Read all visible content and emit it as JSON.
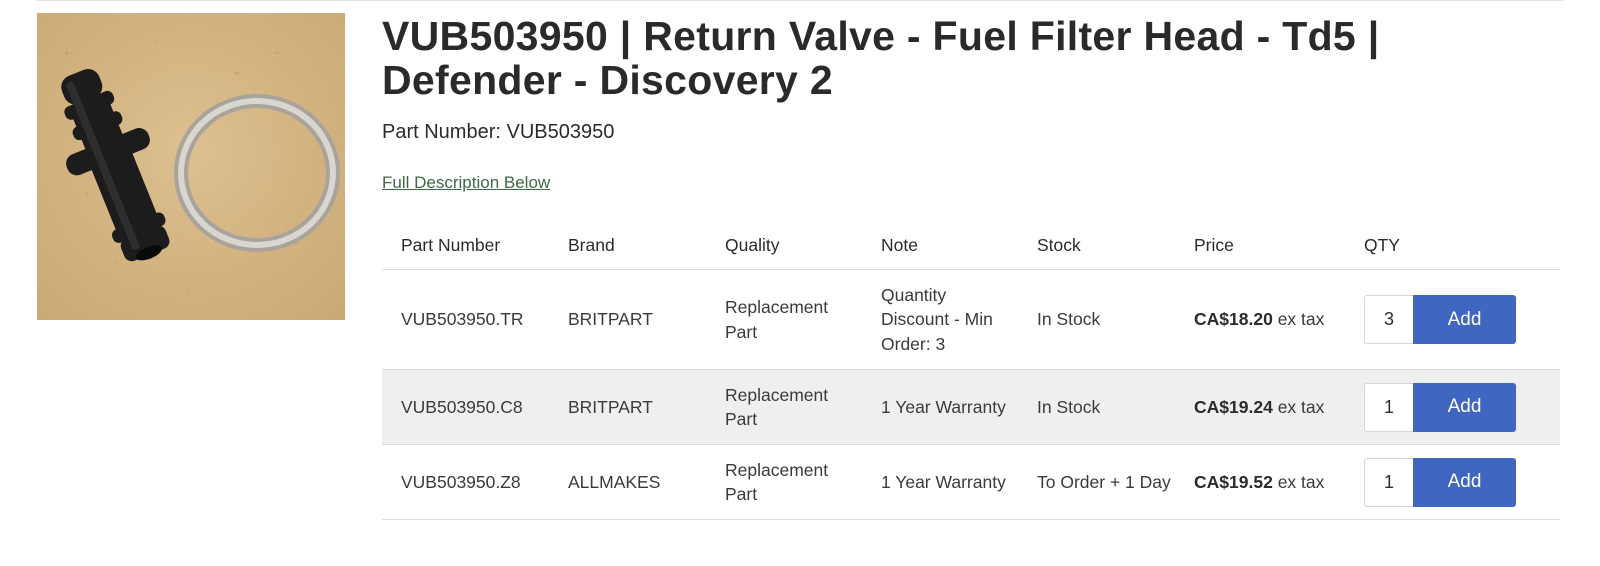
{
  "product": {
    "title": "VUB503950 | Return Valve - Fuel Filter Head - Td5 | Defender - Discovery 2",
    "part_number_label": "Part Number: VUB503950",
    "description_link": "Full Description Below"
  },
  "table": {
    "headers": [
      "Part Number",
      "Brand",
      "Quality",
      "Note",
      "Stock",
      "Price",
      "QTY"
    ],
    "rows": [
      {
        "part": "VUB503950.TR",
        "brand": "BRITPART",
        "quality": "Replacement Part",
        "note": "Quantity Discount - Min Order: 3",
        "stock": "In Stock",
        "price": "CA$18.20",
        "price_suffix": "ex tax",
        "qty": "3",
        "add_label": "Add"
      },
      {
        "part": "VUB503950.C8",
        "brand": "BRITPART",
        "quality": "Replacement Part",
        "note": "1 Year Warranty",
        "stock": "In Stock",
        "price": "CA$19.24",
        "price_suffix": "ex tax",
        "qty": "1",
        "add_label": "Add"
      },
      {
        "part": "VUB503950.Z8",
        "brand": "ALLMAKES",
        "quality": "Replacement Part",
        "note": "1 Year Warranty",
        "stock": "To Order + 1 Day",
        "price": "CA$19.52",
        "price_suffix": "ex tax",
        "qty": "1",
        "add_label": "Add"
      }
    ]
  },
  "colors": {
    "accent_button": "#3f66c0",
    "link": "#3b6a44",
    "alt_row": "#eef0ef"
  }
}
